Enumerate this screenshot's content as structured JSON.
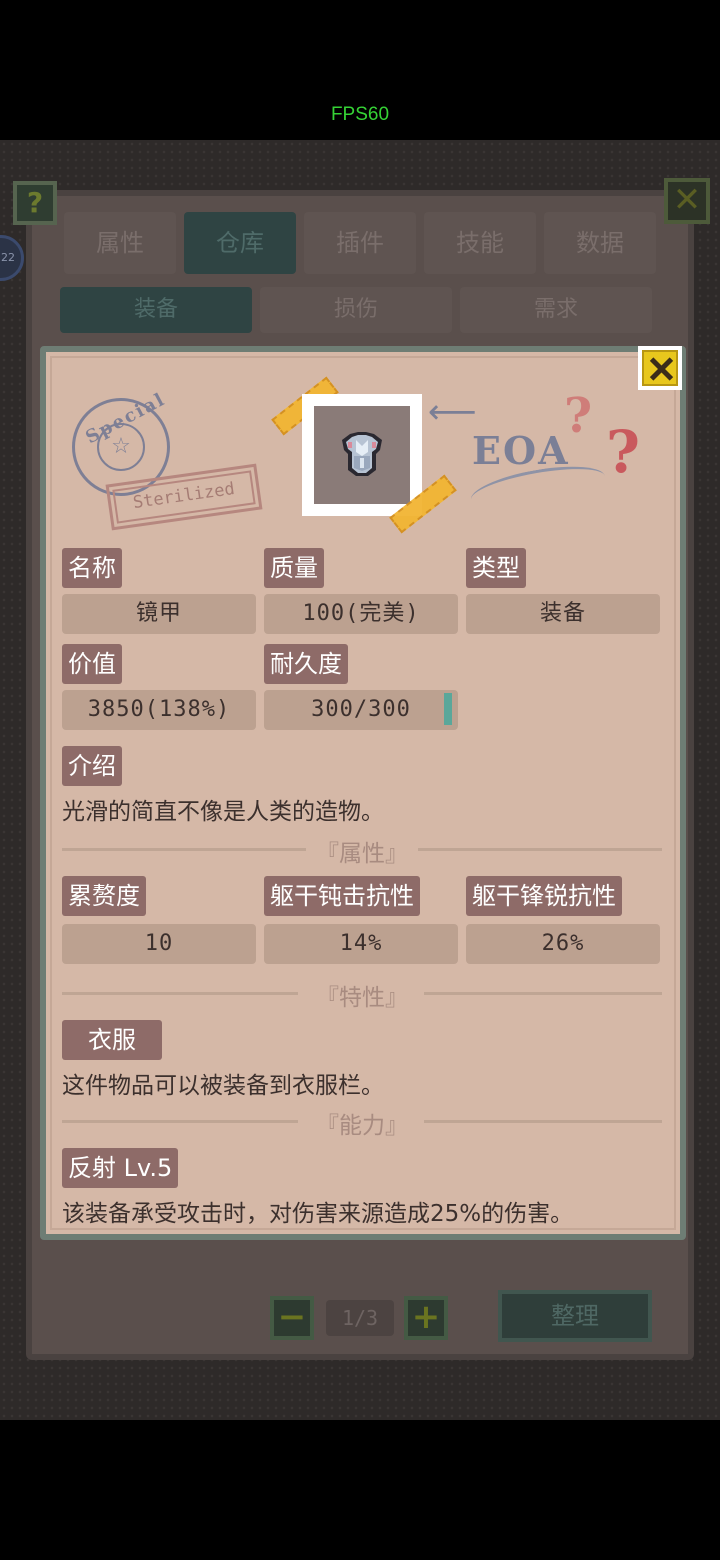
{
  "status": {
    "fps": "FPS60"
  },
  "background_window": {
    "help": "?",
    "close": "✕",
    "side_badge": "22",
    "tabs": [
      {
        "label": "属性",
        "active": false
      },
      {
        "label": "仓库",
        "active": true
      },
      {
        "label": "插件",
        "active": false
      },
      {
        "label": "技能",
        "active": false
      },
      {
        "label": "数据",
        "active": false
      }
    ],
    "subtabs": [
      {
        "label": "装备",
        "active": true
      },
      {
        "label": "损伤",
        "active": false
      },
      {
        "label": "需求",
        "active": false
      }
    ],
    "pager": {
      "minus": "−",
      "plus": "+",
      "page": "1/3"
    },
    "sort_button": "整理"
  },
  "detail": {
    "stamps": {
      "special": "Special",
      "star": "☆",
      "sterilized": "Sterilized",
      "eoa": "EOA",
      "q": "?"
    },
    "fields": {
      "name_label": "名称",
      "name_value": "镜甲",
      "quality_label": "质量",
      "quality_value": "100(完美)",
      "type_label": "类型",
      "type_value": "装备",
      "price_label": "价值",
      "price_value": "3850(138%)",
      "durability_label": "耐久度",
      "durability_value": "300/300"
    },
    "durability_fraction": 1.0,
    "intro_label": "介绍",
    "intro_text": "光滑的简直不像是人类的造物。",
    "attributes_title": "『属性』",
    "attributes": [
      {
        "label": "累赘度",
        "value": "10"
      },
      {
        "label": "躯干钝击抗性",
        "value": "14%"
      },
      {
        "label": "躯干锋锐抗性",
        "value": "26%"
      }
    ],
    "traits_title": "『特性』",
    "trait_label": "衣服",
    "trait_text": "这件物品可以被装备到衣服栏。",
    "abilities_title": "『能力』",
    "ability_label": "反射 Lv.5",
    "ability_text": "该装备承受攻击时，对伤害来源造成25%的伤害。"
  },
  "colors": {
    "panel": "#d5b8a7",
    "label_bg": "#8e6b68",
    "value_bg": "#bca190",
    "close_yellow": "#e8c71d"
  }
}
